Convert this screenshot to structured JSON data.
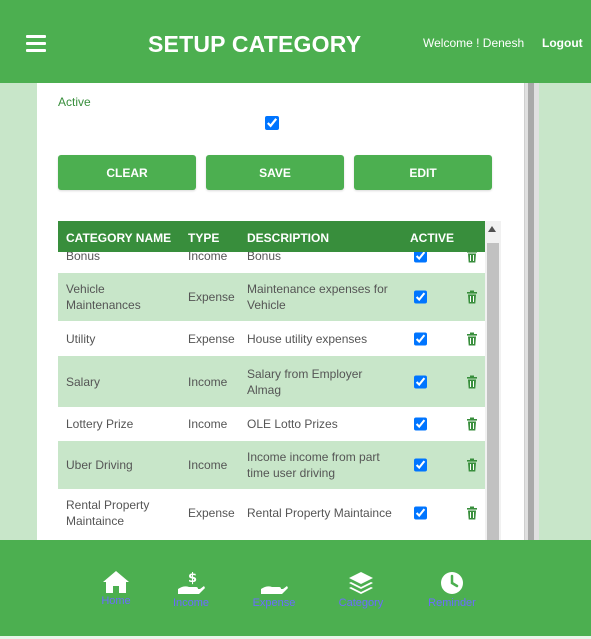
{
  "header": {
    "title": "SETUP CATEGORY",
    "welcome": "Welcome ! Denesh",
    "logout": "Logout"
  },
  "form": {
    "active_label": "Active",
    "active_checked": true
  },
  "buttons": {
    "clear": "CLEAR",
    "save": "SAVE",
    "edit": "EDIT"
  },
  "table": {
    "columns": [
      "CATEGORY NAME",
      "TYPE",
      "DESCRIPTION",
      "ACTIVE"
    ],
    "rows": [
      {
        "name": "Bonus",
        "type": "Income",
        "description": "Bonus",
        "active": true
      },
      {
        "name": "Vehicle Maintenances",
        "type": "Expense",
        "description": "Maintenance expenses for Vehicle",
        "active": true
      },
      {
        "name": "Utility",
        "type": "Expense",
        "description": "House utility expenses",
        "active": true
      },
      {
        "name": "Salary",
        "type": "Income",
        "description": "Salary from Employer Almag",
        "active": true
      },
      {
        "name": "Lottery Prize",
        "type": "Income",
        "description": "OLE Lotto Prizes",
        "active": true
      },
      {
        "name": "Uber Driving",
        "type": "Income",
        "description": "Income income from part time user driving",
        "active": true
      },
      {
        "name": "Rental Property Maintaince",
        "type": "Expense",
        "description": "Rental Property Maintaince",
        "active": true
      }
    ]
  },
  "nav": {
    "items": [
      {
        "label": "Home",
        "icon": "home-icon"
      },
      {
        "label": "Income",
        "icon": "hand-dollar-icon"
      },
      {
        "label": "Expense",
        "icon": "hand-icon"
      },
      {
        "label": "Category",
        "icon": "layers-icon"
      },
      {
        "label": "Reminder",
        "icon": "clock-icon"
      }
    ]
  },
  "colors": {
    "primary": "#4caf50",
    "header_row": "#388e3c",
    "alt_row": "#c8e6c9",
    "nav_label": "#6b6bff"
  }
}
